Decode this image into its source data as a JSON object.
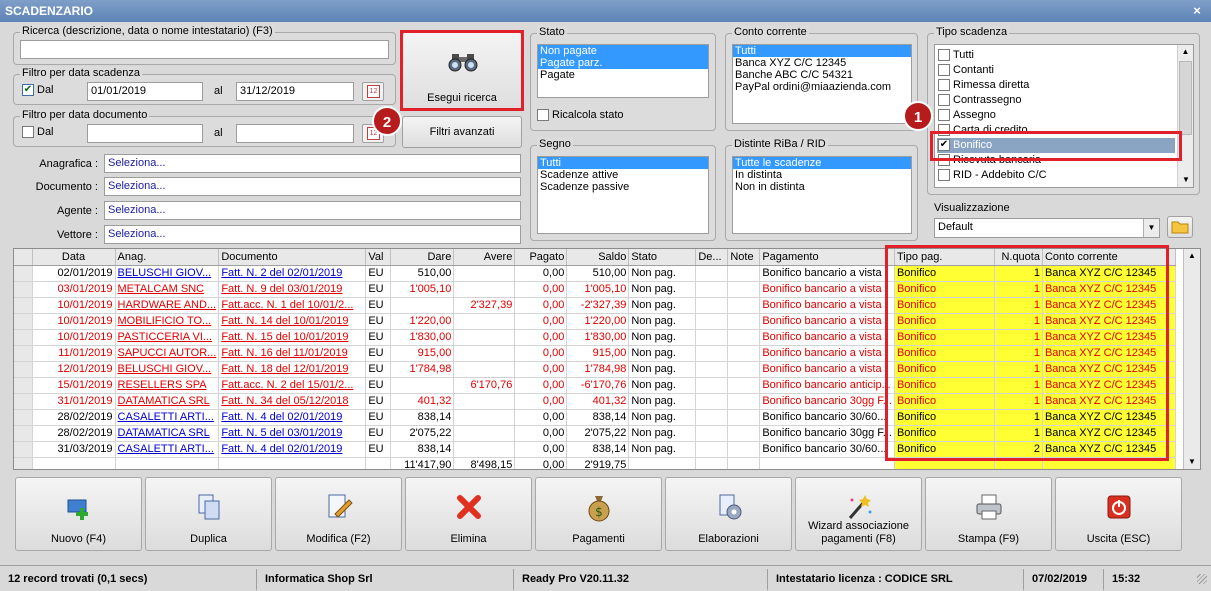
{
  "window": {
    "title": "SCADENZARIO",
    "close": "×"
  },
  "search": {
    "title": "Ricerca (descrizione, data o nome intestatario) (F3)",
    "value": ""
  },
  "due_filter": {
    "title": "Filtro per data scadenza",
    "checked": true,
    "from_label": "Dal",
    "from": "01/01/2019",
    "to_label": "al",
    "to": "31/12/2019"
  },
  "doc_filter": {
    "title": "Filtro per data documento",
    "checked": false,
    "from_label": "Dal",
    "from": "",
    "to_label": "al",
    "to": ""
  },
  "buttons": {
    "search": "Esegui ricerca",
    "advanced": "Filtri avanzati"
  },
  "fields": [
    {
      "label": "Anagrafica :",
      "value": "Seleziona..."
    },
    {
      "label": "Documento :",
      "value": "Seleziona..."
    },
    {
      "label": "Agente :",
      "value": "Seleziona..."
    },
    {
      "label": "Vettore :",
      "value": "Seleziona..."
    }
  ],
  "stato": {
    "title": "Stato",
    "items": [
      "Non pagate",
      "Pagate parz.",
      "Pagate"
    ],
    "selected": [
      0,
      1
    ],
    "recalc": "Ricalcola stato"
  },
  "conto": {
    "title": "Conto corrente",
    "items": [
      "Tutti",
      "Banca XYZ C/C 12345",
      "Banche ABC C/C 54321",
      "PayPal ordini@miaazienda.com"
    ],
    "selected": [
      0
    ]
  },
  "segno": {
    "title": "Segno",
    "items": [
      "Tutti",
      "Scadenze attive",
      "Scadenze passive"
    ],
    "selected": [
      0
    ]
  },
  "distinte": {
    "title": "Distinte RiBa / RID",
    "items": [
      "Tutte le scadenze",
      "In distinta",
      "Non in distinta"
    ],
    "selected": [
      0
    ]
  },
  "tipo": {
    "title": "Tipo scadenza",
    "items": [
      {
        "label": "Tutti",
        "checked": false
      },
      {
        "label": "Contanti",
        "checked": false
      },
      {
        "label": "Rimessa diretta",
        "checked": false
      },
      {
        "label": "Contrassegno",
        "checked": false
      },
      {
        "label": "Assegno",
        "checked": false
      },
      {
        "label": "Carta di credito",
        "checked": false
      },
      {
        "label": "Bonifico",
        "checked": true
      },
      {
        "label": "Ricevuta bancaria",
        "checked": false
      },
      {
        "label": "RID - Addebito C/C",
        "checked": false
      }
    ]
  },
  "view": {
    "title": "Visualizzazione",
    "value": "Default"
  },
  "badges": {
    "one": "1",
    "two": "2"
  },
  "table": {
    "columns": [
      "Data",
      "Anag.",
      "Documento",
      "Val",
      "Dare",
      "Avere",
      "Pagato",
      "Saldo",
      "Stato",
      "De...",
      "Note",
      "Pagamento",
      "Tipo pag.",
      "N.quota",
      "Conto corrente"
    ],
    "rows": [
      {
        "red": false,
        "data": "02/01/2019",
        "anag": "BELUSCHI GIOV...",
        "doc": "Fatt. N. 2 del 02/01/2019",
        "val": "EU",
        "dare": "510,00",
        "avere": "",
        "pagato": "0,00",
        "saldo": "510,00",
        "stato": "Non pag.",
        "de": "",
        "note": "",
        "pag": "Bonifico bancario a vista",
        "tipo": "Bonifico",
        "nq": "1",
        "conto": "Banca XYZ C/C 12345"
      },
      {
        "red": true,
        "data": "03/01/2019",
        "anag": "METALCAM SNC",
        "doc": "Fatt. N. 9 del 03/01/2019",
        "val": "EU",
        "dare": "1'005,10",
        "avere": "",
        "pagato": "0,00",
        "saldo": "1'005,10",
        "stato": "Non pag.",
        "de": "",
        "note": "",
        "pag": "Bonifico bancario a vista",
        "tipo": "Bonifico",
        "nq": "1",
        "conto": "Banca XYZ C/C 12345"
      },
      {
        "red": true,
        "data": "10/01/2019",
        "anag": "HARDWARE AND...",
        "doc": "Fatt.acc. N. 1 del 10/01/2...",
        "val": "EU",
        "dare": "",
        "avere": "2'327,39",
        "pagato": "0,00",
        "saldo": "-2'327,39",
        "stato": "Non pag.",
        "de": "",
        "note": "",
        "pag": "Bonifico bancario a vista",
        "tipo": "Bonifico",
        "nq": "1",
        "conto": "Banca XYZ C/C 12345"
      },
      {
        "red": true,
        "data": "10/01/2019",
        "anag": "MOBILIFICIO TO...",
        "doc": "Fatt. N. 14 del 10/01/2019",
        "val": "EU",
        "dare": "1'220,00",
        "avere": "",
        "pagato": "0,00",
        "saldo": "1'220,00",
        "stato": "Non pag.",
        "de": "",
        "note": "",
        "pag": "Bonifico bancario a vista",
        "tipo": "Bonifico",
        "nq": "1",
        "conto": "Banca XYZ C/C 12345"
      },
      {
        "red": true,
        "data": "10/01/2019",
        "anag": "PASTICCERIA VI...",
        "doc": "Fatt. N. 15 del 10/01/2019",
        "val": "EU",
        "dare": "1'830,00",
        "avere": "",
        "pagato": "0,00",
        "saldo": "1'830,00",
        "stato": "Non pag.",
        "de": "",
        "note": "",
        "pag": "Bonifico bancario a vista",
        "tipo": "Bonifico",
        "nq": "1",
        "conto": "Banca XYZ C/C 12345"
      },
      {
        "red": true,
        "data": "11/01/2019",
        "anag": "SAPUCCI AUTOR...",
        "doc": "Fatt. N. 16 del 11/01/2019",
        "val": "EU",
        "dare": "915,00",
        "avere": "",
        "pagato": "0,00",
        "saldo": "915,00",
        "stato": "Non pag.",
        "de": "",
        "note": "",
        "pag": "Bonifico bancario a vista",
        "tipo": "Bonifico",
        "nq": "1",
        "conto": "Banca XYZ C/C 12345"
      },
      {
        "red": true,
        "data": "12/01/2019",
        "anag": "BELUSCHI GIOV...",
        "doc": "Fatt. N. 18 del 12/01/2019",
        "val": "EU",
        "dare": "1'784,98",
        "avere": "",
        "pagato": "0,00",
        "saldo": "1'784,98",
        "stato": "Non pag.",
        "de": "",
        "note": "",
        "pag": "Bonifico bancario a vista",
        "tipo": "Bonifico",
        "nq": "1",
        "conto": "Banca XYZ C/C 12345"
      },
      {
        "red": true,
        "data": "15/01/2019",
        "anag": "RESELLERS SPA",
        "doc": "Fatt.acc. N. 2 del 15/01/2...",
        "val": "EU",
        "dare": "",
        "avere": "6'170,76",
        "pagato": "0,00",
        "saldo": "-6'170,76",
        "stato": "Non pag.",
        "de": "",
        "note": "",
        "pag": "Bonifico bancario anticip...",
        "tipo": "Bonifico",
        "nq": "1",
        "conto": "Banca XYZ C/C 12345"
      },
      {
        "red": true,
        "data": "31/01/2019",
        "anag": "DATAMATICA SRL",
        "doc": "Fatt. N. 34 del 05/12/2018",
        "val": "EU",
        "dare": "401,32",
        "avere": "",
        "pagato": "0,00",
        "saldo": "401,32",
        "stato": "Non pag.",
        "de": "",
        "note": "",
        "pag": "Bonifico bancario 30gg F...",
        "tipo": "Bonifico",
        "nq": "1",
        "conto": "Banca XYZ C/C 12345"
      },
      {
        "red": false,
        "data": "28/02/2019",
        "anag": "CASALETTI ARTI...",
        "doc": "Fatt. N. 4 del 02/01/2019",
        "val": "EU",
        "dare": "838,14",
        "avere": "",
        "pagato": "0,00",
        "saldo": "838,14",
        "stato": "Non pag.",
        "de": "",
        "note": "",
        "pag": "Bonifico bancario 30/60...",
        "tipo": "Bonifico",
        "nq": "1",
        "conto": "Banca XYZ C/C 12345"
      },
      {
        "red": false,
        "data": "28/02/2019",
        "anag": "DATAMATICA SRL",
        "doc": "Fatt. N. 5 del 03/01/2019",
        "val": "EU",
        "dare": "2'075,22",
        "avere": "",
        "pagato": "0,00",
        "saldo": "2'075,22",
        "stato": "Non pag.",
        "de": "",
        "note": "",
        "pag": "Bonifico bancario 30gg F...",
        "tipo": "Bonifico",
        "nq": "1",
        "conto": "Banca XYZ C/C 12345"
      },
      {
        "red": false,
        "data": "31/03/2019",
        "anag": "CASALETTI ARTI...",
        "doc": "Fatt. N. 4 del 02/01/2019",
        "val": "EU",
        "dare": "838,14",
        "avere": "",
        "pagato": "0,00",
        "saldo": "838,14",
        "stato": "Non pag.",
        "de": "",
        "note": "",
        "pag": "Bonifico bancario 30/60...",
        "tipo": "Bonifico",
        "nq": "2",
        "conto": "Banca XYZ C/C 12345"
      }
    ],
    "totals": {
      "dare": "11'417,90",
      "avere": "8'498,15",
      "pagato": "0,00",
      "saldo": "2'919,75"
    }
  },
  "actions": [
    {
      "name": "nuovo-button",
      "icon": "new-record-icon",
      "label": "Nuovo (F4)"
    },
    {
      "name": "duplica-button",
      "icon": "duplicate-icon",
      "label": "Duplica"
    },
    {
      "name": "modifica-button",
      "icon": "edit-icon",
      "label": "Modifica (F2)"
    },
    {
      "name": "elimina-button",
      "icon": "delete-icon",
      "label": "Elimina"
    },
    {
      "name": "pagamenti-button",
      "icon": "money-bag-icon",
      "label": "Pagamenti"
    },
    {
      "name": "elaborazioni-button",
      "icon": "process-icon",
      "label": "Elaborazioni"
    },
    {
      "name": "wizard-button",
      "icon": "magic-wand-icon",
      "label": "Wizard associazione pagamenti (F8)"
    },
    {
      "name": "stampa-button",
      "icon": "printer-icon",
      "label": "Stampa (F9)"
    },
    {
      "name": "uscita-button",
      "icon": "exit-icon",
      "label": "Uscita (ESC)"
    }
  ],
  "status": {
    "records": "12 record trovati (0,1 secs)",
    "company": "Informatica Shop Srl",
    "version": "Ready Pro V20.11.32",
    "license": "Intestatario licenza : CODICE SRL",
    "date": "07/02/2019",
    "time": "15:32"
  },
  "colors": {
    "selection": "#3399ff",
    "highlight": "#ffff33",
    "annotation": "#e0202a",
    "overdue": "#e00000"
  }
}
